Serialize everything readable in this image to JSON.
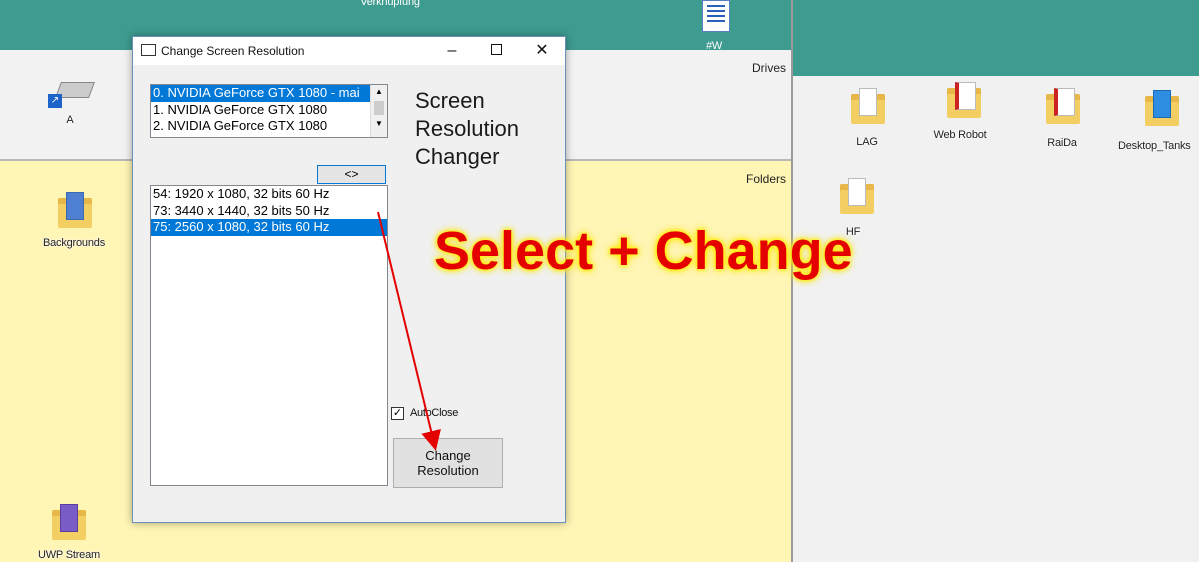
{
  "desktop": {
    "top_caption": "Verknüpfung",
    "top_icon_label": "#W",
    "drives_label": "Drives",
    "folders_label": "Folders",
    "drive_a_label": "A",
    "backgrounds_label": "Backgrounds",
    "uwp_label": "UWP Stream",
    "right_icons": [
      {
        "label": "LAG"
      },
      {
        "label": "Web Robot"
      },
      {
        "label": "RaiDa"
      },
      {
        "label": "Desktop_Tanks"
      },
      {
        "label": "HF"
      }
    ]
  },
  "dialog": {
    "title": "Change Screen Resolution",
    "gpu_list": [
      {
        "label": "0. NVIDIA GeForce GTX 1080 - mai",
        "selected": true
      },
      {
        "label": "1. NVIDIA GeForce GTX 1080",
        "selected": false
      },
      {
        "label": "2. NVIDIA GeForce GTX 1080",
        "selected": false
      }
    ],
    "heading_lines": [
      "Screen",
      "Resolution",
      "Changer"
    ],
    "swap_label": "<>",
    "modes": [
      {
        "label": "54: 1920 x 1080, 32 bits 60 Hz",
        "selected": false
      },
      {
        "label": "73: 3440 x 1440, 32 bits 50 Hz",
        "selected": false
      },
      {
        "label": "75: 2560 x 1080, 32 bits 60 Hz",
        "selected": true
      }
    ],
    "autoclose_label": "AutoClose",
    "autoclose_checked": "✓",
    "change_lines": [
      "Change",
      "Resolution"
    ]
  },
  "annotation": "Select + Change",
  "colors": {
    "accent": "#0078d7",
    "annotation": "#e50000",
    "teal": "#3e9b8f"
  }
}
